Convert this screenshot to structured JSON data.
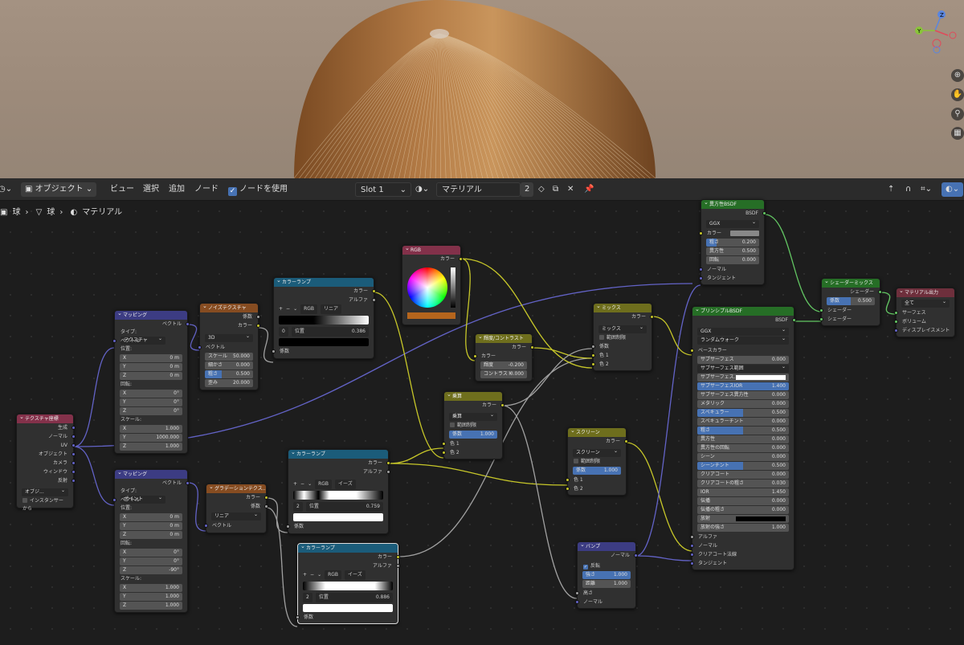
{
  "header": {
    "mode": "オブジェクト",
    "menus": [
      "ビュー",
      "選択",
      "追加",
      "ノード"
    ],
    "use_nodes": "ノードを使用",
    "slot": "Slot 1",
    "material_name": "マテリアル",
    "user_count": "2"
  },
  "breadcrumb": {
    "object": "球",
    "mesh": "球",
    "material": "マテリアル"
  },
  "nodes": {
    "texcoord": {
      "title": "テクスチャ座標",
      "outputs": [
        "生成",
        "ノーマル",
        "UV",
        "オブジェクト",
        "カメラ",
        "ウィンドウ",
        "反射"
      ],
      "object_label": "オブジ...",
      "from_instancer": "インスタンサーから"
    },
    "mapping1": {
      "title": "マッピング",
      "out": "ベクトル",
      "type_label": "タイプ:",
      "type_value": "テクスチャ",
      "vector": "ベクトル",
      "location": "位置:",
      "loc": [
        "0 m",
        "0 m",
        "0 m"
      ],
      "rotation": "回転:",
      "rot": [
        "0°",
        "0°",
        "0°"
      ],
      "scale": "スケール:",
      "scl": [
        "1.000",
        "1000.000",
        "1.000"
      ]
    },
    "mapping2": {
      "title": "マッピング",
      "out": "ベクトル",
      "type_label": "タイプ:",
      "type_value": "ポイント",
      "vector": "ベクトル",
      "location": "位置:",
      "loc": [
        "0 m",
        "0 m",
        "0 m"
      ],
      "rotation": "回転:",
      "rot": [
        "0°",
        "0°",
        "-90°"
      ],
      "scale": "スケール:",
      "scl": [
        "1.000",
        "1.000",
        "1.000"
      ]
    },
    "axes": [
      "X",
      "Y",
      "Z"
    ],
    "noise": {
      "title": "ノイズテクスチャ",
      "outputs": [
        "係数",
        "カラー"
      ],
      "dims": "3D",
      "vector": "ベクトル",
      "params": [
        {
          "label": "スケール",
          "value": "50.000"
        },
        {
          "label": "細かさ",
          "value": "0.000"
        },
        {
          "label": "粗さ",
          "value": "0.500"
        },
        {
          "label": "歪み",
          "value": "20.000"
        }
      ]
    },
    "gradient": {
      "title": "グラデーションテクス...",
      "outputs": [
        "カラー",
        "係数"
      ],
      "type": "リニア",
      "vector": "ベクトル"
    },
    "ramp1": {
      "title": "カラーランプ",
      "outputs": [
        "カラー",
        "アルファ"
      ],
      "mode": "RGB",
      "interp": "リニア",
      "index": "0",
      "pos_label": "位置",
      "pos": "0.386",
      "input": "係数"
    },
    "ramp2": {
      "title": "カラーランプ",
      "outputs": [
        "カラー",
        "アルファ"
      ],
      "mode": "RGB",
      "interp": "イーズ",
      "index": "2",
      "pos_label": "位置",
      "pos": "0.759",
      "input": "係数"
    },
    "ramp3": {
      "title": "カラーランプ",
      "outputs": [
        "カラー",
        "アルファ"
      ],
      "mode": "RGB",
      "interp": "イーズ",
      "index": "2",
      "pos_label": "位置",
      "pos": "0.886",
      "input": "係数"
    },
    "rgb": {
      "title": "RGB",
      "out": "カラー"
    },
    "bc": {
      "title": "輝度/コントラスト",
      "out": "カラー",
      "in": "カラー",
      "params": [
        {
          "label": "輝度",
          "value": "-0.200"
        },
        {
          "label": "コントラスト",
          "value": "0.000"
        }
      ]
    },
    "mix1": {
      "title": "ミックス",
      "out": "カラー",
      "blend": "ミックス",
      "clamp": "範囲制限",
      "inputs": [
        "係数",
        "色 1",
        "色 2"
      ]
    },
    "mult": {
      "title": "乗算",
      "out": "カラー",
      "blend": "乗算",
      "clamp": "範囲制限",
      "fac_label": "係数",
      "fac": "1.000",
      "inputs": [
        "色 1",
        "色 2"
      ]
    },
    "screen": {
      "title": "スクリーン",
      "out": "カラー",
      "blend": "スクリーン",
      "clamp": "範囲制限",
      "fac_label": "係数",
      "fac": "1.000",
      "inputs": [
        "色 1",
        "色 2"
      ]
    },
    "bump": {
      "title": "バンプ",
      "out": "ノーマル",
      "invert": "反転",
      "params": [
        {
          "label": "強さ",
          "value": "1.000"
        },
        {
          "label": "距離",
          "value": "1.000"
        }
      ],
      "inputs": [
        "高さ",
        "ノーマル"
      ]
    },
    "aniso": {
      "title": "異方性BSDF",
      "out": "BSDF",
      "dist": "GGX",
      "color": "カラー",
      "params": [
        {
          "label": "粗さ",
          "value": "0.200"
        },
        {
          "label": "異方性",
          "value": "0.500"
        },
        {
          "label": "回転",
          "value": "0.000"
        }
      ],
      "inputs": [
        "ノーマル",
        "タンジェント"
      ]
    },
    "principled": {
      "title": "プリンシプルBSDF",
      "out": "BSDF",
      "dist": "GGX",
      "sss_method": "ランダムウォーク",
      "base_color": "ベースカラー",
      "params": [
        {
          "label": "サブサーフェス",
          "value": "0.000"
        },
        {
          "label": "サブサーフェス範囲",
          "value": ""
        },
        {
          "label": "サブサーフェス...",
          "value": ""
        },
        {
          "label": "サブサーフェスIOR",
          "value": "1.400"
        },
        {
          "label": "サブサーフェス異方性",
          "value": "0.000"
        },
        {
          "label": "メタリック",
          "value": "0.000"
        },
        {
          "label": "スペキュラー",
          "value": "0.500"
        },
        {
          "label": "スペキュラーチント",
          "value": "0.000"
        },
        {
          "label": "粗さ",
          "value": "0.500"
        },
        {
          "label": "異方性",
          "value": "0.000"
        },
        {
          "label": "異方性の回転",
          "value": "0.000"
        },
        {
          "label": "シーン",
          "value": "0.000"
        },
        {
          "label": "シーンチント",
          "value": "0.500"
        },
        {
          "label": "クリアコート",
          "value": "0.000"
        },
        {
          "label": "クリアコートの粗さ",
          "value": "0.030"
        },
        {
          "label": "IOR",
          "value": "1.450"
        },
        {
          "label": "伝播",
          "value": "0.000"
        },
        {
          "label": "伝播の粗さ",
          "value": "0.000"
        },
        {
          "label": "放射",
          "value": ""
        },
        {
          "label": "放射の強さ",
          "value": "1.000"
        }
      ],
      "inputs": [
        "アルファ",
        "ノーマル",
        "クリアコート法線",
        "タンジェント"
      ]
    },
    "shmix": {
      "title": "シェーダーミックス",
      "out": "シェーダー",
      "fac_label": "係数",
      "fac": "0.500",
      "inputs": [
        "シェーダー",
        "シェーダー"
      ]
    },
    "out": {
      "title": "マテリアル出力",
      "target": "全て",
      "inputs": [
        "サーフェス",
        "ボリューム",
        "ディスプレイスメント"
      ]
    }
  },
  "colors": {
    "input": "#83314a",
    "vector": "#3c3c83",
    "texture": "#864c21",
    "converter": "#1b5c7a",
    "color": "#6e6e1d",
    "shader": "#266e26",
    "output": "#6e2f3c",
    "wire_color": "#c7c729",
    "wire_shader": "#63c763",
    "wire_vector": "#6363c7",
    "wire_float": "#a1a1a1"
  }
}
